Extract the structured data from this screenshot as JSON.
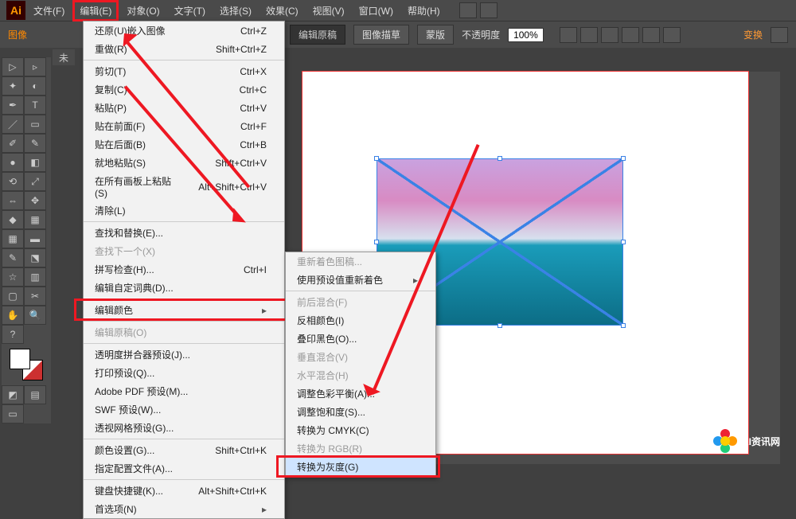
{
  "app_logo_text": "Ai",
  "menubar": [
    "文件(F)",
    "编辑(E)",
    "对象(O)",
    "文字(T)",
    "选择(S)",
    "效果(C)",
    "视图(V)",
    "窗口(W)",
    "帮助(H)"
  ],
  "image_label": "图像",
  "tab_title": "未",
  "optionsbar": {
    "edit_original": "编辑原稿",
    "image_trace": "图像描草",
    "mask": "蒙版",
    "opacity_label": "不透明度",
    "opacity_value": "100%",
    "transform": "变换",
    "xy_icon": "⊞"
  },
  "edit_menu": [
    {
      "label": "还原(U)嵌入图像",
      "shortcut": "Ctrl+Z"
    },
    {
      "label": "重做(R)",
      "shortcut": "Shift+Ctrl+Z"
    },
    {
      "sep": true
    },
    {
      "label": "剪切(T)",
      "shortcut": "Ctrl+X"
    },
    {
      "label": "复制(C)",
      "shortcut": "Ctrl+C"
    },
    {
      "label": "粘贴(P)",
      "shortcut": "Ctrl+V"
    },
    {
      "label": "贴在前面(F)",
      "shortcut": "Ctrl+F"
    },
    {
      "label": "贴在后面(B)",
      "shortcut": "Ctrl+B"
    },
    {
      "label": "就地粘贴(S)",
      "shortcut": "Shift+Ctrl+V"
    },
    {
      "label": "在所有画板上粘贴(S)",
      "shortcut": "Alt+Shift+Ctrl+V"
    },
    {
      "label": "清除(L)"
    },
    {
      "sep": true
    },
    {
      "label": "查找和替换(E)..."
    },
    {
      "label": "查找下一个(X)",
      "disabled": true
    },
    {
      "label": "拼写检查(H)...",
      "shortcut": "Ctrl+I"
    },
    {
      "label": "编辑自定词典(D)..."
    },
    {
      "sep": true
    },
    {
      "label": "编辑颜色",
      "sub": true,
      "hl": true
    },
    {
      "sep": true
    },
    {
      "label": "编辑原稿(O)",
      "disabled": true
    },
    {
      "sep": true
    },
    {
      "label": "透明度拼合器预设(J)..."
    },
    {
      "label": "打印预设(Q)..."
    },
    {
      "label": "Adobe PDF 预设(M)..."
    },
    {
      "label": "SWF 预设(W)..."
    },
    {
      "label": "透视网格预设(G)..."
    },
    {
      "sep": true
    },
    {
      "label": "颜色设置(G)...",
      "shortcut": "Shift+Ctrl+K"
    },
    {
      "label": "指定配置文件(A)..."
    },
    {
      "sep": true
    },
    {
      "label": "键盘快捷键(K)...",
      "shortcut": "Alt+Shift+Ctrl+K"
    },
    {
      "label": "首选项(N)",
      "sub": true
    }
  ],
  "submenu": [
    {
      "label": "重新着色图稿...",
      "disabled": true
    },
    {
      "label": "使用预设值重新着色",
      "sub": true
    },
    {
      "sep": true
    },
    {
      "label": "前后混合(F)",
      "disabled": true
    },
    {
      "label": "反相颜色(I)"
    },
    {
      "label": "叠印黑色(O)..."
    },
    {
      "label": "垂直混合(V)",
      "disabled": true
    },
    {
      "label": "水平混合(H)",
      "disabled": true
    },
    {
      "label": "调整色彩平衡(A)..."
    },
    {
      "label": "调整饱和度(S)..."
    },
    {
      "label": "转换为 CMYK(C)"
    },
    {
      "label": "转换为 RGB(R)",
      "disabled": true
    },
    {
      "label": "转换为灰度(G)",
      "hl": true,
      "hover": true
    }
  ],
  "watermark_text": "AI资讯网"
}
